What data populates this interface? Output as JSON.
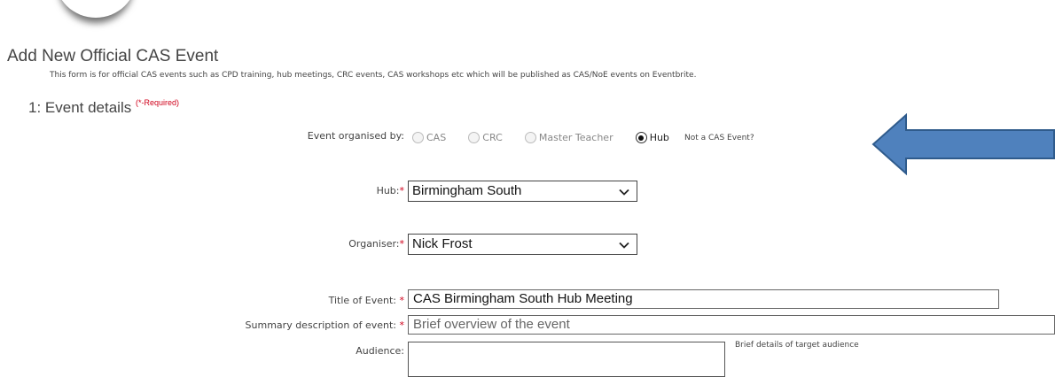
{
  "page": {
    "title": "Add New Official CAS Event",
    "intro": "This form is for official CAS events such as CPD training, hub meetings, CRC events, CAS workshops etc which will be published as CAS/NoE events on Eventbrite."
  },
  "section": {
    "heading": "1: Event details",
    "required_note": "(*-Required)"
  },
  "organised_by": {
    "label": "Event organised by:",
    "options": [
      {
        "label": "CAS",
        "checked": false
      },
      {
        "label": "CRC",
        "checked": false
      },
      {
        "label": "Master Teacher",
        "checked": false
      },
      {
        "label": "Hub",
        "checked": true
      }
    ],
    "not_cas_link": "Not a CAS Event?"
  },
  "hub": {
    "label": "Hub:",
    "required_mark": "*",
    "value": "Birmingham South"
  },
  "organiser": {
    "label": "Organiser:",
    "required_mark": "*",
    "value": "Nick Frost"
  },
  "title_of_event": {
    "label": "Title of Event:",
    "required_mark": " *",
    "value": "CAS Birmingham South Hub Meeting"
  },
  "summary": {
    "label": "Summary description of event:",
    "required_mark": " *",
    "placeholder": "Brief overview of the event"
  },
  "audience": {
    "label": "Audience:",
    "hint": "Brief details of target audience"
  },
  "colors": {
    "arrow_fill": "#4f81bd",
    "arrow_stroke": "#2f5b8c",
    "required": "#d0021b"
  }
}
